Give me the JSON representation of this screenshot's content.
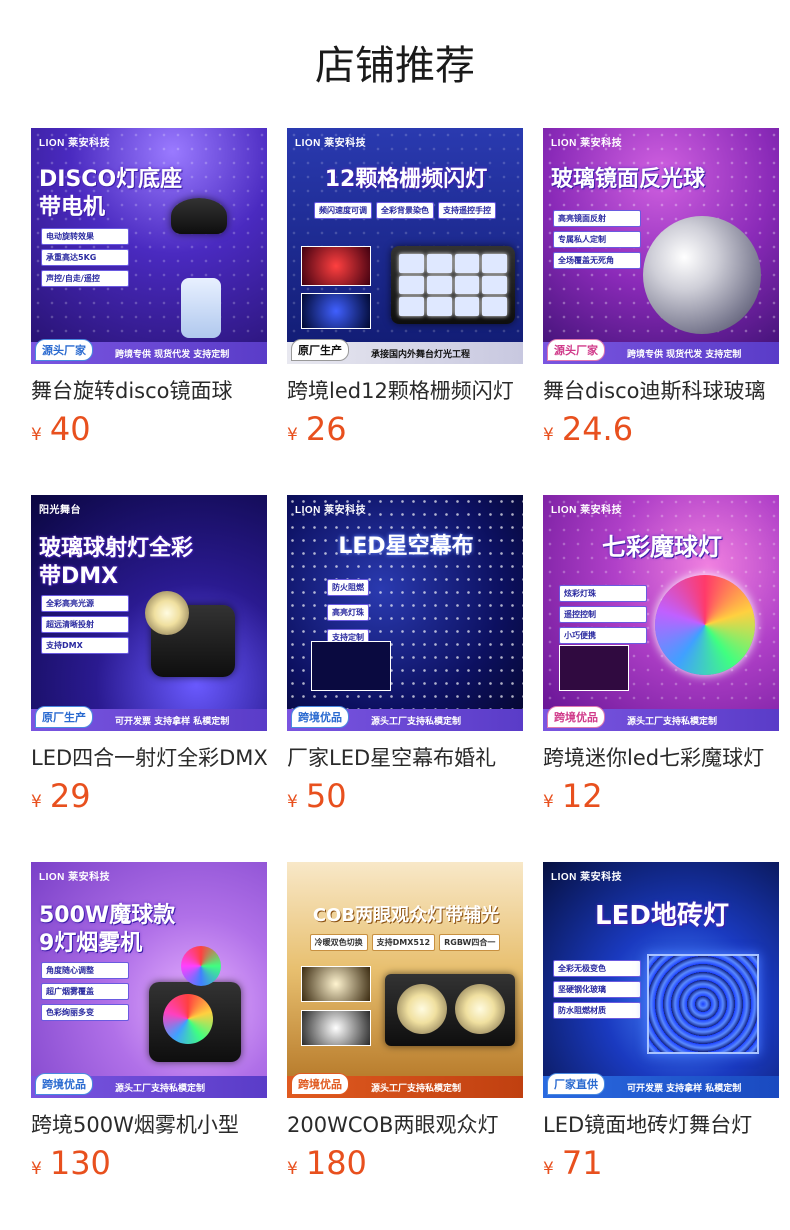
{
  "page": {
    "title": "店铺推荐"
  },
  "currency_symbol": "¥",
  "products": [
    {
      "name": "舞台旋转disco镜面球",
      "price": "40",
      "image": {
        "brand": "LION 莱安科技",
        "headline": "DISCO灯底座\n带电机",
        "tags": [
          "电动旋转效果",
          "承重高达5KG",
          "声控/自走/遥控"
        ],
        "badge": "源头厂家",
        "bottom_text": "跨境专供  现货代发  支持定制",
        "theme": "#3a1ea0"
      }
    },
    {
      "name": "跨境led12颗格栅频闪灯",
      "price": "26",
      "image": {
        "brand": "LION 莱安科技",
        "headline": "12颗格栅频闪灯",
        "tags": [
          "频闪速度可调",
          "全彩背景染色",
          "支持遥控手控"
        ],
        "badge": "原厂生产",
        "bottom_text": "承接国内外舞台灯光工程",
        "theme": "#1a2a8a"
      }
    },
    {
      "name": "舞台disco迪斯科球玻璃",
      "price": "24.6",
      "image": {
        "brand": "LION 莱安科技",
        "headline": "玻璃镜面反光球",
        "tags": [
          "高亮镜面反射",
          "专属私人定制",
          "全场覆盖无死角"
        ],
        "badge": "源头厂家",
        "bottom_text": "跨境专供  现货代发  支持定制",
        "theme": "#7a2ab0"
      }
    },
    {
      "name": "LED四合一射灯全彩DMX",
      "price": "29",
      "image": {
        "brand": "阳光舞台",
        "headline": "玻璃球射灯全彩\n带DMX",
        "tags": [
          "全彩高亮光源",
          "超远清晰投射",
          "支持DMX"
        ],
        "badge": "原厂生产",
        "bottom_text": "可开发票  支持拿样  私模定制",
        "theme": "#1e1a80"
      }
    },
    {
      "name": "厂家LED星空幕布婚礼",
      "price": "50",
      "image": {
        "brand": "LION 莱安科技",
        "headline": "LED星空幕布",
        "tags": [
          "防火阻燃",
          "高亮灯珠",
          "支持定制"
        ],
        "badge": "跨境优品",
        "bottom_text": "源头工厂支持私模定制",
        "theme": "#0e1450"
      }
    },
    {
      "name": "跨境迷你led七彩魔球灯",
      "price": "12",
      "image": {
        "brand": "LION 莱安科技",
        "headline": "七彩魔球灯",
        "tags": [
          "炫彩灯珠",
          "遥控控制",
          "小巧便携"
        ],
        "badge": "跨境优品",
        "bottom_text": "源头工厂支持私模定制",
        "theme": "#9a2ab8"
      }
    },
    {
      "name": "跨境500W烟雾机小型",
      "price": "130",
      "image": {
        "brand": "LION 莱安科技",
        "headline": "500W魔球款\n9灯烟雾机",
        "tags": [
          "角度随心调整",
          "超广烟雾覆盖",
          "色彩绚丽多变"
        ],
        "badge": "跨境优品",
        "bottom_text": "源头工厂支持私模定制",
        "theme": "#a04ad0"
      }
    },
    {
      "name": "200WCOB两眼观众灯",
      "price": "180",
      "image": {
        "brand": "",
        "headline": "COB两眼观众灯带辅光",
        "tags": [
          "冷暖双色切换",
          "支持DMX512",
          "RGBW四合一"
        ],
        "badge": "跨境优品",
        "bottom_text": "源头工厂支持私模定制",
        "theme": "#c08a3a"
      }
    },
    {
      "name": "LED镜面地砖灯舞台灯",
      "price": "71",
      "image": {
        "brand": "LION 莱安科技",
        "headline": "LED地砖灯",
        "tags": [
          "全彩无极变色",
          "坚硬钢化玻璃",
          "防水阻燃材质"
        ],
        "badge": "厂家直供",
        "bottom_text": "可开发票  支持拿样  私模定制",
        "theme": "#0a2a9a"
      }
    }
  ]
}
